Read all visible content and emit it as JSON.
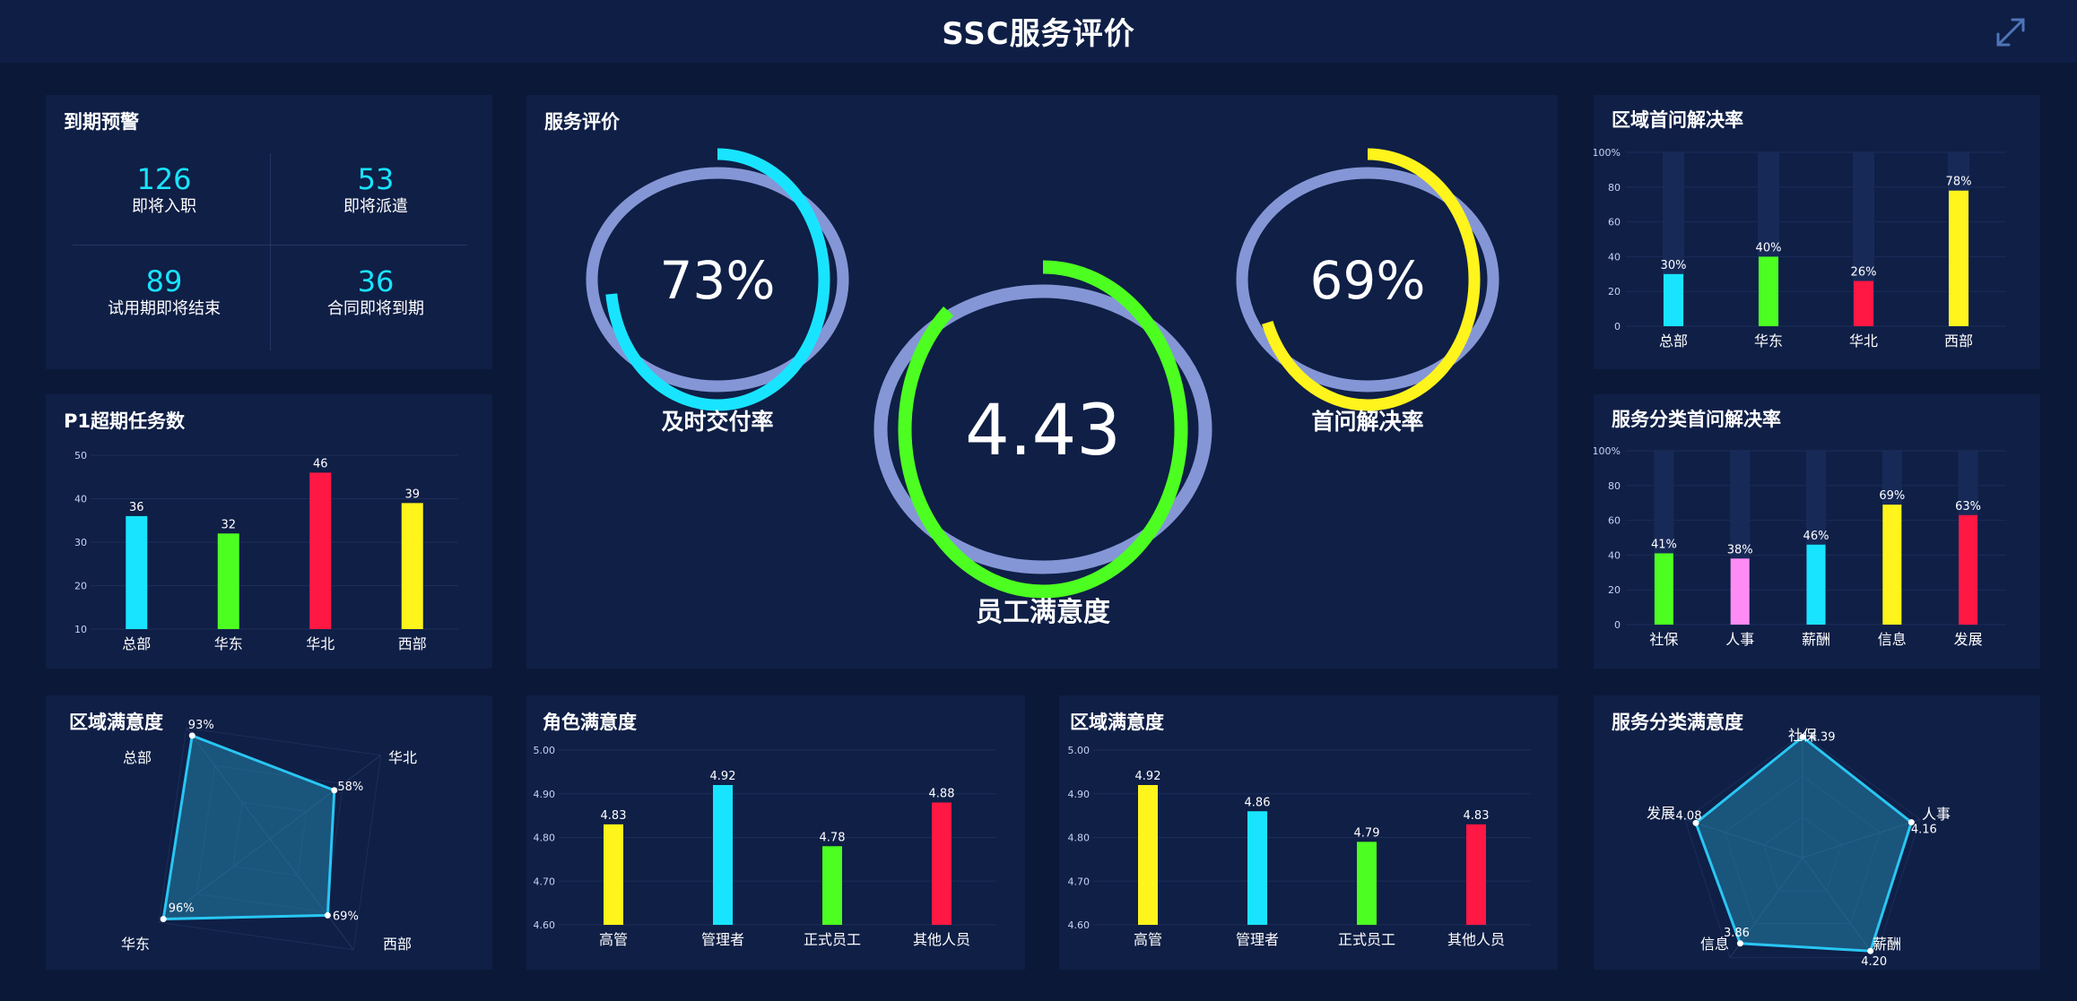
{
  "header": {
    "title": "SSC服务评价",
    "expand_icon": "expand-icon"
  },
  "expiry_alerts": {
    "title": "到期预警",
    "items": [
      {
        "value": "126",
        "label": "即将入职"
      },
      {
        "value": "53",
        "label": "即将派遣"
      },
      {
        "value": "89",
        "label": "试用期即将结束"
      },
      {
        "value": "36",
        "label": "合同即将到期"
      }
    ]
  },
  "service_eval": {
    "title": "服务评价",
    "gauges": [
      {
        "id": "timely",
        "value_text": "73%",
        "fraction": 0.73,
        "label": "及时交付率",
        "color": "#19e4ff"
      },
      {
        "id": "satisfaction",
        "value_text": "4.43",
        "fraction": 0.886,
        "label": "员工满意度",
        "color": "#4dff21"
      },
      {
        "id": "first",
        "value_text": "69%",
        "fraction": 0.69,
        "label": "首问解决率",
        "color": "#fff41c"
      }
    ],
    "track_color": "#8596d6"
  },
  "chart_data": [
    {
      "id": "p1_overdue",
      "type": "bar",
      "title": "P1超期任务数",
      "categories": [
        "总部",
        "华东",
        "华北",
        "西部"
      ],
      "values": [
        36,
        32,
        46,
        39
      ],
      "value_labels": [
        "36",
        "32",
        "46",
        "39"
      ],
      "colors": [
        "#19e4ff",
        "#4dff21",
        "#ff1844",
        "#fff41c"
      ],
      "ylim": [
        10,
        50
      ],
      "yticks": [
        "10",
        "20",
        "30",
        "40",
        "50"
      ],
      "grid": true
    },
    {
      "id": "region_first_resolve",
      "type": "bar",
      "title": "区域首问解决率",
      "categories": [
        "总部",
        "华东",
        "华北",
        "西部"
      ],
      "values": [
        30,
        40,
        26,
        78
      ],
      "value_labels": [
        "30%",
        "40%",
        "26%",
        "78%"
      ],
      "colors": [
        "#19e4ff",
        "#4dff21",
        "#ff1844",
        "#fff41c"
      ],
      "ylim": [
        0,
        100
      ],
      "yticks": [
        "0",
        "20",
        "40",
        "60",
        "80",
        "100%"
      ],
      "grid": true
    },
    {
      "id": "category_first_resolve",
      "type": "bar",
      "title": "服务分类首问解决率",
      "categories": [
        "社保",
        "人事",
        "薪酬",
        "信息",
        "发展"
      ],
      "values": [
        41,
        38,
        46,
        69,
        63
      ],
      "value_labels": [
        "41%",
        "38%",
        "46%",
        "69%",
        "63%"
      ],
      "colors": [
        "#4dff21",
        "#ff8cf4",
        "#19e4ff",
        "#fff41c",
        "#ff1844"
      ],
      "ylim": [
        0,
        100
      ],
      "yticks": [
        "0",
        "20",
        "40",
        "60",
        "80",
        "100%"
      ],
      "grid": true
    },
    {
      "id": "region_satisfaction_radar",
      "type": "radar",
      "title": "区域满意度",
      "axes": [
        "总部",
        "华北",
        "西部",
        "华东"
      ],
      "values": [
        93,
        58,
        69,
        96
      ],
      "value_labels": [
        "93%",
        "58%",
        "69%",
        "96%"
      ],
      "max": 100
    },
    {
      "id": "role_satisfaction",
      "type": "bar",
      "title": "角色满意度",
      "categories": [
        "高管",
        "管理者",
        "正式员工",
        "其他人员"
      ],
      "values": [
        4.83,
        4.92,
        4.78,
        4.88
      ],
      "value_labels": [
        "4.83",
        "4.92",
        "4.78",
        "4.88"
      ],
      "colors": [
        "#fff41c",
        "#19e4ff",
        "#4dff21",
        "#ff1844"
      ],
      "ylim": [
        4.6,
        5.0
      ],
      "yticks": [
        "4.60",
        "4.70",
        "4.80",
        "4.90",
        "5.00"
      ],
      "grid": true
    },
    {
      "id": "region_satisfaction_bar",
      "type": "bar",
      "title": "区域满意度",
      "categories": [
        "高管",
        "管理者",
        "正式员工",
        "其他人员"
      ],
      "values": [
        4.92,
        4.86,
        4.79,
        4.83
      ],
      "value_labels": [
        "4.92",
        "4.86",
        "4.79",
        "4.83"
      ],
      "colors": [
        "#fff41c",
        "#19e4ff",
        "#4dff21",
        "#ff1844"
      ],
      "ylim": [
        4.6,
        5.0
      ],
      "yticks": [
        "4.60",
        "4.70",
        "4.80",
        "4.90",
        "5.00"
      ],
      "grid": true
    },
    {
      "id": "category_satisfaction_radar",
      "type": "radar",
      "title": "服务分类满意度",
      "axes": [
        "社保",
        "人事",
        "薪酬",
        "信息",
        "发展"
      ],
      "values": [
        4.39,
        4.16,
        4.2,
        3.86,
        4.08
      ],
      "value_labels": [
        "4.39",
        "4.16",
        "4.20",
        "3.86",
        "4.08"
      ],
      "max": 4.5
    }
  ]
}
